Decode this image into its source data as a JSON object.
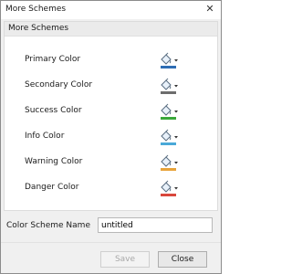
{
  "window": {
    "title": "More Schemes",
    "close_glyph": "✕"
  },
  "group": {
    "header": "More Schemes"
  },
  "colors": [
    {
      "label": "Primary Color",
      "swatch": "#2e6db4"
    },
    {
      "label": "Secondary Color",
      "swatch": "#6d6d6d"
    },
    {
      "label": "Success Color",
      "swatch": "#3aa83a"
    },
    {
      "label": "Info Color",
      "swatch": "#4aa9d8"
    },
    {
      "label": "Warning Color",
      "swatch": "#e8a33a"
    },
    {
      "label": "Danger Color",
      "swatch": "#d9473c"
    }
  ],
  "picker_icon": "paint-bucket-icon",
  "scheme_name": {
    "label": "Color Scheme Name",
    "value": "untitled"
  },
  "buttons": {
    "save": "Save",
    "close": "Close"
  }
}
